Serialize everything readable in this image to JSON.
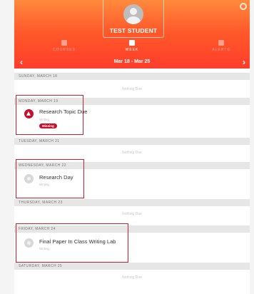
{
  "header": {
    "student_name": "TEST STUDENT",
    "tabs": [
      {
        "label": "COURSES",
        "active": false
      },
      {
        "label": "WEEK",
        "active": true
      },
      {
        "label": "ALERTS",
        "active": false
      }
    ],
    "week_range": "Mar 18 - Mar 25",
    "accent": "#ff5a2a"
  },
  "days": [
    {
      "label": "SUNDAY, MARCH 18",
      "empty_text": "Nothing Due"
    },
    {
      "label": "MONDAY, MARCH 19",
      "item": {
        "title": "Research Topic Due",
        "sub": "Writing",
        "badge": "Missing"
      }
    },
    {
      "label": "TUESDAY, MARCH 21",
      "empty_text": "Nothing Due"
    },
    {
      "label": "WEDNESDAY, MARCH 22",
      "item": {
        "title": "Research Day",
        "sub": "Writing"
      }
    },
    {
      "label": "THURSDAY, MARCH 23",
      "empty_text": "Nothing Due"
    },
    {
      "label": "FRIDAY, MARCH 24",
      "item": {
        "title": "Final Paper In Class Writing Lab",
        "sub": "Writing"
      }
    },
    {
      "label": "SATURDAY, MARCH 25",
      "empty_text": "Nothing Due"
    }
  ],
  "colors": {
    "missing": "#c8102e",
    "highlight": "#c8202e"
  }
}
